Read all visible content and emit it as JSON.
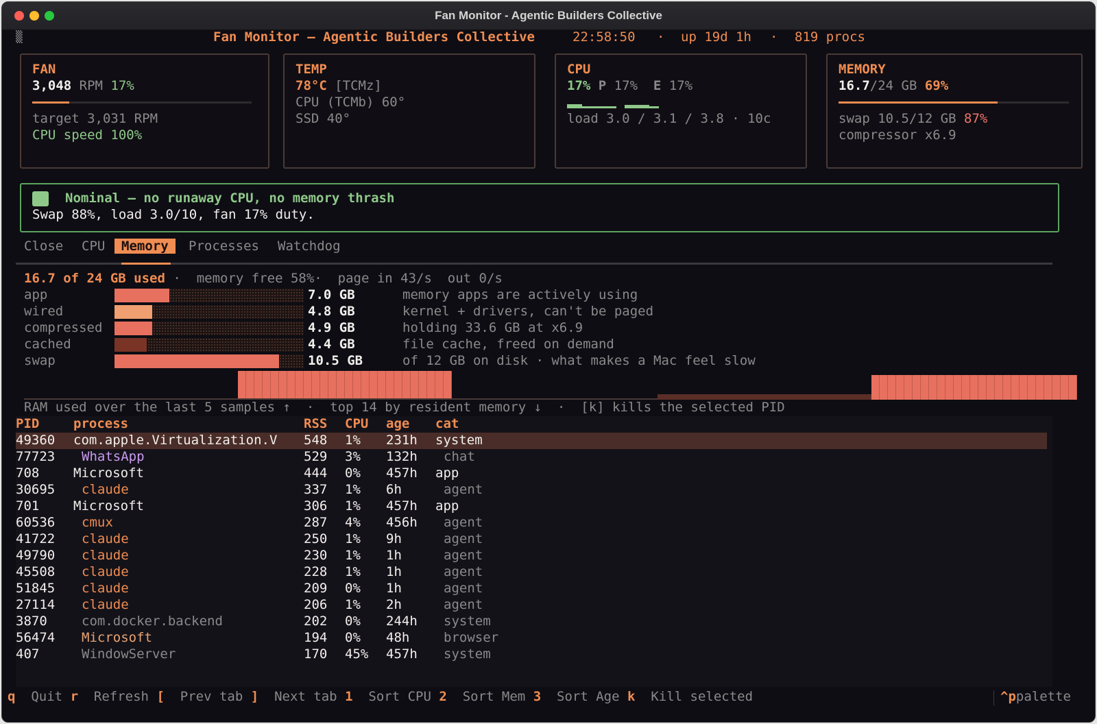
{
  "window": {
    "title": "Fan Monitor - Agentic Builders Collective"
  },
  "header": {
    "icon": "app-icon",
    "title": "Fan Monitor — Agentic Builders Collective",
    "sep": "—",
    "time": "22:58:50",
    "uptime": "up 19d 1h",
    "procs": "819 procs",
    "dot": "·"
  },
  "panels": {
    "fan": {
      "title": "FAN",
      "rpm": "3,048",
      "rpm_unit": "RPM",
      "pct": "17%",
      "bar": 0.17,
      "target": "target 3,031 RPM",
      "cpu_speed": "CPU speed 100%"
    },
    "temp": {
      "title": "TEMP",
      "main": "78°C",
      "sensor": "[TCMz]",
      "cpu": "CPU (TCMb) 60°",
      "ssd": "SSD 40°"
    },
    "cpu": {
      "title": "CPU",
      "total": "17%",
      "p_label": "P",
      "p": "17%",
      "e_label": "E",
      "e": "17%",
      "load": "load 3.0 / 3.1 / 3.8 · 10c"
    },
    "memory": {
      "title": "MEMORY",
      "used": "16.7",
      "total": "/24 GB",
      "pct": "69%",
      "bar": 0.69,
      "swap": "swap 10.5/12 GB",
      "swap_pct": "87%",
      "compressor": "compressor x6.9"
    }
  },
  "status": {
    "headline": "Nominal — no runaway CPU, no memory thrash",
    "detail": "Swap 88%, load 3.0/10, fan 17% duty.",
    "color": "#8fc98a"
  },
  "tabs": [
    "Close",
    "CPU",
    "Memory",
    "Processes",
    "Watchdog"
  ],
  "active_tab": "Memory",
  "memory_view": {
    "summary": "16.7 of 24 GB used",
    "free": "memory free 58%",
    "paging": "page in 43/s  out 0/s",
    "dot": "·",
    "rows": [
      {
        "label": "app",
        "value": "7.0 GB",
        "desc": "memory apps are actively using",
        "fraction": 0.29,
        "color": "#e8705f"
      },
      {
        "label": "wired",
        "value": "4.8 GB",
        "desc": "kernel + drivers, can't be paged",
        "fraction": 0.2,
        "color": "#f0a070"
      },
      {
        "label": "compressed",
        "value": "4.9 GB",
        "desc": "holding 33.6 GB at x6.9",
        "fraction": 0.2,
        "color": "#e8705f"
      },
      {
        "label": "cached",
        "value": "4.4 GB",
        "desc": "file cache, freed on demand",
        "fraction": 0.17,
        "color": "#7a3426"
      },
      {
        "label": "swap",
        "value": "10.5 GB",
        "desc": "of 12 GB on disk · what makes a Mac feel slow",
        "fraction": 0.87,
        "color": "#e8705f"
      }
    ],
    "caption_left": "RAM used over the last 5 samples ↑",
    "caption_mid": "top 14 by resident memory ↓",
    "caption_right": "[k] kills the selected PID"
  },
  "table": {
    "columns": {
      "pid": "PID",
      "process": "process",
      "rss": "RSS",
      "cpu": "CPU",
      "age": "age",
      "cat": "cat"
    },
    "rows": [
      {
        "pid": "49360",
        "process": "com.apple.Virtualization.V",
        "rss": "548",
        "cpu": "1%",
        "age": "231h",
        "cat": "system",
        "tone": "white",
        "indent": false
      },
      {
        "pid": "77723",
        "process": "WhatsApp",
        "rss": "529",
        "cpu": "3%",
        "age": "132h",
        "cat": "chat",
        "tone": "purple",
        "indent": true
      },
      {
        "pid": "708",
        "process": "Microsoft",
        "rss": "444",
        "cpu": "0%",
        "age": "457h",
        "cat": "app",
        "tone": "white",
        "indent": false
      },
      {
        "pid": "30695",
        "process": "claude",
        "rss": "337",
        "cpu": "1%",
        "age": "6h",
        "cat": "agent",
        "tone": "orange",
        "indent": true
      },
      {
        "pid": "701",
        "process": "Microsoft",
        "rss": "306",
        "cpu": "1%",
        "age": "457h",
        "cat": "app",
        "tone": "white",
        "indent": false
      },
      {
        "pid": "60536",
        "process": "cmux",
        "rss": "287",
        "cpu": "4%",
        "age": "456h",
        "cat": "agent",
        "tone": "orange",
        "indent": true
      },
      {
        "pid": "41722",
        "process": "claude",
        "rss": "250",
        "cpu": "1%",
        "age": "9h",
        "cat": "agent",
        "tone": "orange",
        "indent": true
      },
      {
        "pid": "49790",
        "process": "claude",
        "rss": "230",
        "cpu": "1%",
        "age": "1h",
        "cat": "agent",
        "tone": "orange",
        "indent": true
      },
      {
        "pid": "45508",
        "process": "claude",
        "rss": "228",
        "cpu": "1%",
        "age": "1h",
        "cat": "agent",
        "tone": "orange",
        "indent": true
      },
      {
        "pid": "51845",
        "process": "claude",
        "rss": "209",
        "cpu": "0%",
        "age": "1h",
        "cat": "agent",
        "tone": "orange",
        "indent": true
      },
      {
        "pid": "27114",
        "process": "claude",
        "rss": "206",
        "cpu": "1%",
        "age": "2h",
        "cat": "agent",
        "tone": "orange",
        "indent": true
      },
      {
        "pid": "3870",
        "process": "com.docker.backend",
        "rss": "202",
        "cpu": "0%",
        "age": "244h",
        "cat": "system",
        "tone": "dim",
        "indent": true
      },
      {
        "pid": "56474",
        "process": "Microsoft",
        "rss": "194",
        "cpu": "0%",
        "age": "48h",
        "cat": "browser",
        "tone": "peach",
        "indent": true
      },
      {
        "pid": "407",
        "process": "WindowServer",
        "rss": "170",
        "cpu": "45%",
        "age": "457h",
        "cat": "system",
        "tone": "dim",
        "indent": true
      }
    ]
  },
  "footer": {
    "keys": [
      {
        "key": "q",
        "label": "Quit"
      },
      {
        "key": "r",
        "label": "Refresh"
      },
      {
        "key": "[",
        "label": "Prev tab"
      },
      {
        "key": "]",
        "label": "Next tab"
      },
      {
        "key": "1",
        "label": "Sort CPU"
      },
      {
        "key": "2",
        "label": "Sort Mem"
      },
      {
        "key": "3",
        "label": "Sort Age"
      },
      {
        "key": "k",
        "label": "Kill selected"
      }
    ],
    "palette_key": "^p",
    "palette_label": "palette"
  }
}
